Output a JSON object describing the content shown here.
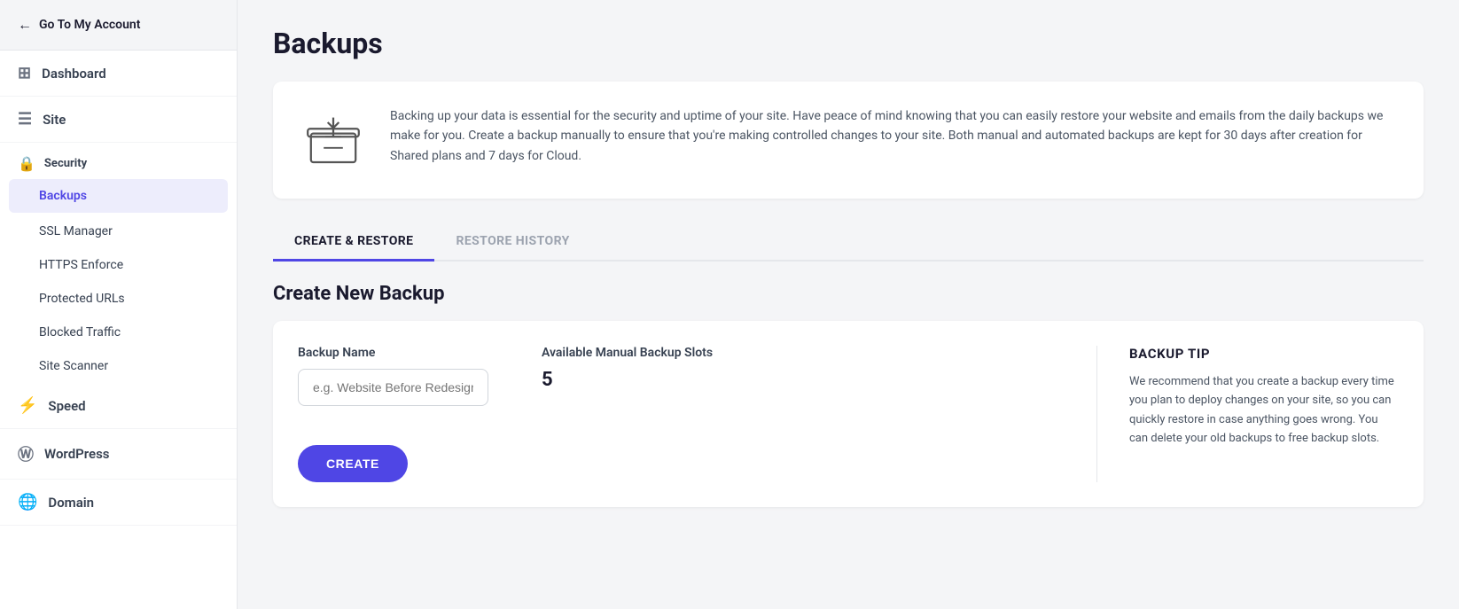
{
  "sidebar": {
    "go_back_label": "Go To My Account",
    "items": [
      {
        "id": "dashboard",
        "label": "Dashboard",
        "icon": "⊞"
      },
      {
        "id": "site",
        "label": "Site",
        "icon": "☰"
      },
      {
        "id": "security",
        "label": "Security",
        "icon": "🔒"
      }
    ],
    "security_sub_items": [
      {
        "id": "backups",
        "label": "Backups",
        "active": true
      },
      {
        "id": "ssl-manager",
        "label": "SSL Manager",
        "active": false
      },
      {
        "id": "https-enforce",
        "label": "HTTPS Enforce",
        "active": false
      },
      {
        "id": "protected-urls",
        "label": "Protected URLs",
        "active": false
      },
      {
        "id": "blocked-traffic",
        "label": "Blocked Traffic",
        "active": false
      },
      {
        "id": "site-scanner",
        "label": "Site Scanner",
        "active": false
      }
    ],
    "bottom_items": [
      {
        "id": "speed",
        "label": "Speed",
        "icon": "⚡"
      },
      {
        "id": "wordpress",
        "label": "WordPress",
        "icon": "Ⓦ"
      },
      {
        "id": "domain",
        "label": "Domain",
        "icon": "🌐"
      }
    ]
  },
  "page": {
    "title": "Backups",
    "info_text": "Backing up your data is essential for the security and uptime of your site. Have peace of mind knowing that you can easily restore your website and emails from the daily backups we make for you. Create a backup manually to ensure that you're making controlled changes to your site. Both manual and automated backups are kept for 30 days after creation for Shared plans and 7 days for Cloud.",
    "tabs": [
      {
        "id": "create-restore",
        "label": "CREATE & RESTORE",
        "active": true
      },
      {
        "id": "restore-history",
        "label": "RESTORE HISTORY",
        "active": false
      }
    ],
    "section_title": "Create New Backup",
    "form": {
      "backup_name_label": "Backup Name",
      "backup_name_placeholder": "e.g. Website Before Redesign",
      "slots_label": "Available Manual Backup Slots",
      "slots_value": "5",
      "create_button_label": "CREATE"
    },
    "tip": {
      "title": "BACKUP TIP",
      "text": "We recommend that you create a backup every time you plan to deploy changes on your site, so you can quickly restore in case anything goes wrong. You can delete your old backups to free backup slots."
    }
  }
}
